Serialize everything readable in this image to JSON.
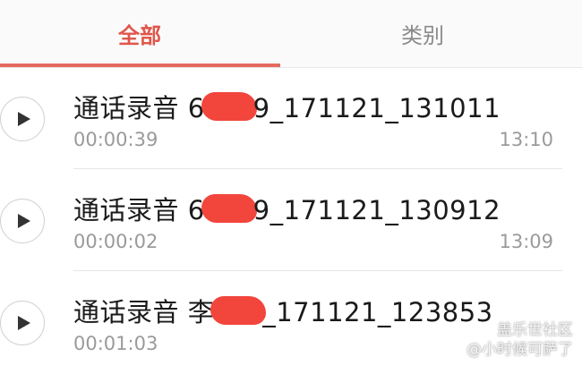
{
  "tabs": [
    {
      "label": "全部",
      "active": true
    },
    {
      "label": "类别",
      "active": false
    }
  ],
  "recordings": [
    {
      "title_prefix": "通话录音 6",
      "title_suffix": "9_171121_131011",
      "duration": "00:00:39",
      "time": "13:10"
    },
    {
      "title_prefix": "通话录音 6",
      "title_suffix": "9_171121_130912",
      "duration": "00:00:02",
      "time": "13:09"
    },
    {
      "title_prefix": "通话录音 李",
      "title_suffix": "_171121_123853",
      "duration": "00:01:03",
      "time": ""
    }
  ],
  "watermark": {
    "line1": "盖乐世社区",
    "line2": "@小时候可萨了"
  },
  "colors": {
    "accent": "#e0554a",
    "redaction": "#f2453c"
  },
  "icons": {
    "play": "play-icon"
  }
}
